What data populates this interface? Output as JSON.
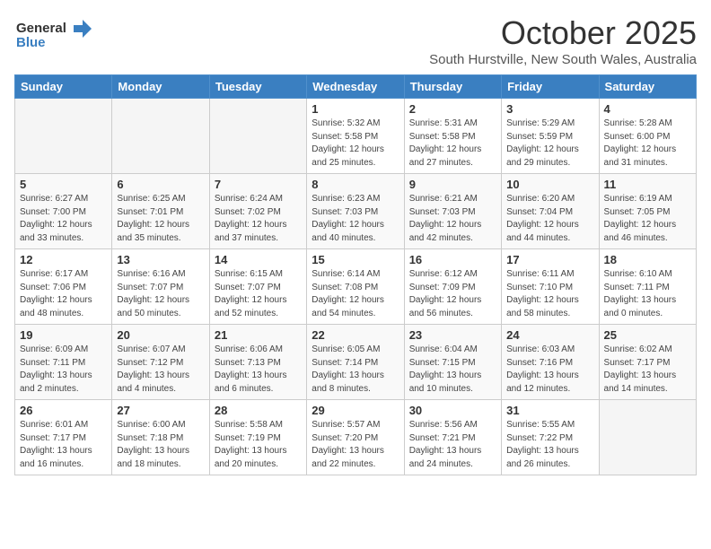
{
  "header": {
    "logo_general": "General",
    "logo_blue": "Blue",
    "month_title": "October 2025",
    "location": "South Hurstville, New South Wales, Australia"
  },
  "days_of_week": [
    "Sunday",
    "Monday",
    "Tuesday",
    "Wednesday",
    "Thursday",
    "Friday",
    "Saturday"
  ],
  "weeks": [
    [
      {
        "num": "",
        "info": ""
      },
      {
        "num": "",
        "info": ""
      },
      {
        "num": "",
        "info": ""
      },
      {
        "num": "1",
        "info": "Sunrise: 5:32 AM\nSunset: 5:58 PM\nDaylight: 12 hours\nand 25 minutes."
      },
      {
        "num": "2",
        "info": "Sunrise: 5:31 AM\nSunset: 5:58 PM\nDaylight: 12 hours\nand 27 minutes."
      },
      {
        "num": "3",
        "info": "Sunrise: 5:29 AM\nSunset: 5:59 PM\nDaylight: 12 hours\nand 29 minutes."
      },
      {
        "num": "4",
        "info": "Sunrise: 5:28 AM\nSunset: 6:00 PM\nDaylight: 12 hours\nand 31 minutes."
      }
    ],
    [
      {
        "num": "5",
        "info": "Sunrise: 6:27 AM\nSunset: 7:00 PM\nDaylight: 12 hours\nand 33 minutes."
      },
      {
        "num": "6",
        "info": "Sunrise: 6:25 AM\nSunset: 7:01 PM\nDaylight: 12 hours\nand 35 minutes."
      },
      {
        "num": "7",
        "info": "Sunrise: 6:24 AM\nSunset: 7:02 PM\nDaylight: 12 hours\nand 37 minutes."
      },
      {
        "num": "8",
        "info": "Sunrise: 6:23 AM\nSunset: 7:03 PM\nDaylight: 12 hours\nand 40 minutes."
      },
      {
        "num": "9",
        "info": "Sunrise: 6:21 AM\nSunset: 7:03 PM\nDaylight: 12 hours\nand 42 minutes."
      },
      {
        "num": "10",
        "info": "Sunrise: 6:20 AM\nSunset: 7:04 PM\nDaylight: 12 hours\nand 44 minutes."
      },
      {
        "num": "11",
        "info": "Sunrise: 6:19 AM\nSunset: 7:05 PM\nDaylight: 12 hours\nand 46 minutes."
      }
    ],
    [
      {
        "num": "12",
        "info": "Sunrise: 6:17 AM\nSunset: 7:06 PM\nDaylight: 12 hours\nand 48 minutes."
      },
      {
        "num": "13",
        "info": "Sunrise: 6:16 AM\nSunset: 7:07 PM\nDaylight: 12 hours\nand 50 minutes."
      },
      {
        "num": "14",
        "info": "Sunrise: 6:15 AM\nSunset: 7:07 PM\nDaylight: 12 hours\nand 52 minutes."
      },
      {
        "num": "15",
        "info": "Sunrise: 6:14 AM\nSunset: 7:08 PM\nDaylight: 12 hours\nand 54 minutes."
      },
      {
        "num": "16",
        "info": "Sunrise: 6:12 AM\nSunset: 7:09 PM\nDaylight: 12 hours\nand 56 minutes."
      },
      {
        "num": "17",
        "info": "Sunrise: 6:11 AM\nSunset: 7:10 PM\nDaylight: 12 hours\nand 58 minutes."
      },
      {
        "num": "18",
        "info": "Sunrise: 6:10 AM\nSunset: 7:11 PM\nDaylight: 13 hours\nand 0 minutes."
      }
    ],
    [
      {
        "num": "19",
        "info": "Sunrise: 6:09 AM\nSunset: 7:11 PM\nDaylight: 13 hours\nand 2 minutes."
      },
      {
        "num": "20",
        "info": "Sunrise: 6:07 AM\nSunset: 7:12 PM\nDaylight: 13 hours\nand 4 minutes."
      },
      {
        "num": "21",
        "info": "Sunrise: 6:06 AM\nSunset: 7:13 PM\nDaylight: 13 hours\nand 6 minutes."
      },
      {
        "num": "22",
        "info": "Sunrise: 6:05 AM\nSunset: 7:14 PM\nDaylight: 13 hours\nand 8 minutes."
      },
      {
        "num": "23",
        "info": "Sunrise: 6:04 AM\nSunset: 7:15 PM\nDaylight: 13 hours\nand 10 minutes."
      },
      {
        "num": "24",
        "info": "Sunrise: 6:03 AM\nSunset: 7:16 PM\nDaylight: 13 hours\nand 12 minutes."
      },
      {
        "num": "25",
        "info": "Sunrise: 6:02 AM\nSunset: 7:17 PM\nDaylight: 13 hours\nand 14 minutes."
      }
    ],
    [
      {
        "num": "26",
        "info": "Sunrise: 6:01 AM\nSunset: 7:17 PM\nDaylight: 13 hours\nand 16 minutes."
      },
      {
        "num": "27",
        "info": "Sunrise: 6:00 AM\nSunset: 7:18 PM\nDaylight: 13 hours\nand 18 minutes."
      },
      {
        "num": "28",
        "info": "Sunrise: 5:58 AM\nSunset: 7:19 PM\nDaylight: 13 hours\nand 20 minutes."
      },
      {
        "num": "29",
        "info": "Sunrise: 5:57 AM\nSunset: 7:20 PM\nDaylight: 13 hours\nand 22 minutes."
      },
      {
        "num": "30",
        "info": "Sunrise: 5:56 AM\nSunset: 7:21 PM\nDaylight: 13 hours\nand 24 minutes."
      },
      {
        "num": "31",
        "info": "Sunrise: 5:55 AM\nSunset: 7:22 PM\nDaylight: 13 hours\nand 26 minutes."
      },
      {
        "num": "",
        "info": ""
      }
    ]
  ]
}
